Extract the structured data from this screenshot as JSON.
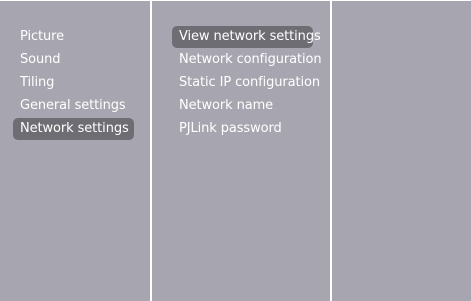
{
  "colors": {
    "background": "#a7a5af",
    "highlight": "#6e6d74",
    "text": "#ffffff",
    "divider": "#ffffff"
  },
  "main_menu": {
    "items": [
      {
        "label": "Picture",
        "selected": false
      },
      {
        "label": "Sound",
        "selected": false
      },
      {
        "label": "Tiling",
        "selected": false
      },
      {
        "label": "General settings",
        "selected": false
      },
      {
        "label": "Network settings",
        "selected": true
      }
    ]
  },
  "network_menu": {
    "items": [
      {
        "label": "View network settings",
        "selected": true
      },
      {
        "label": "Network configuration",
        "selected": false
      },
      {
        "label": "Static IP configuration",
        "selected": false
      },
      {
        "label": "Network name",
        "selected": false
      },
      {
        "label": "PJLink password",
        "selected": false
      }
    ]
  },
  "detail_panel": {
    "items": []
  }
}
